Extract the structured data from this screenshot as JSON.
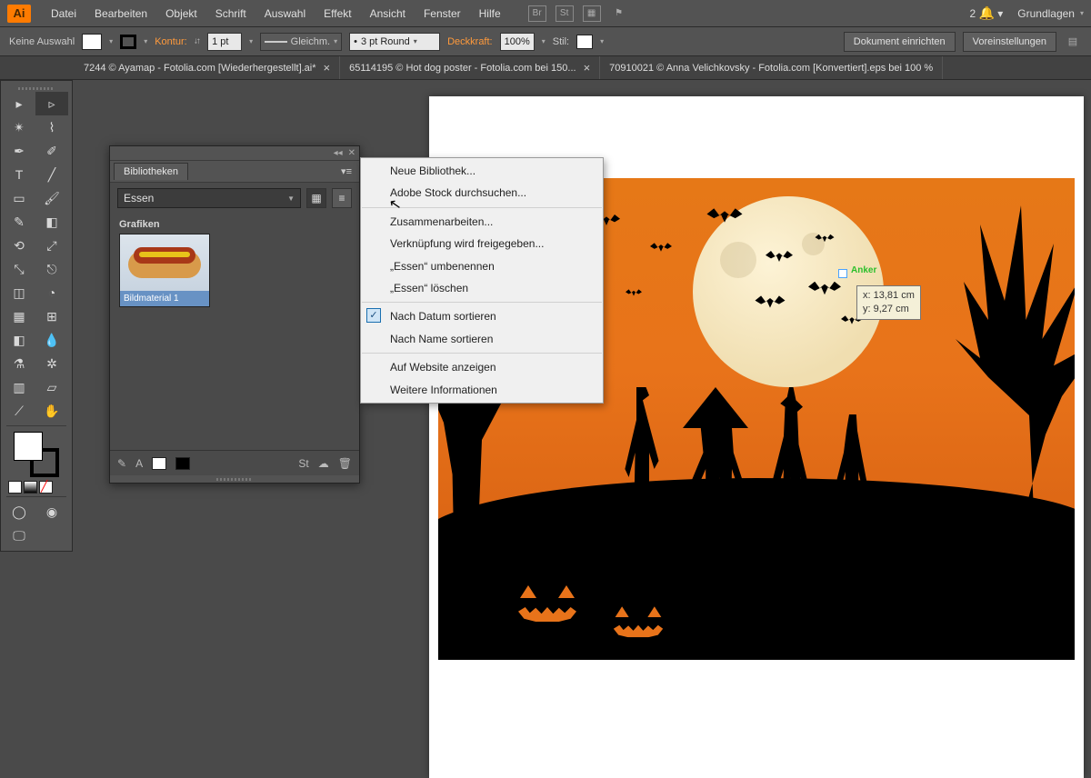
{
  "app": {
    "logo": "Ai"
  },
  "menu": [
    "Datei",
    "Bearbeiten",
    "Objekt",
    "Schrift",
    "Auswahl",
    "Effekt",
    "Ansicht",
    "Fenster",
    "Hilfe"
  ],
  "menubar_right": {
    "notif_count": "2",
    "workspace": "Grundlagen"
  },
  "control": {
    "selection": "Keine Auswahl",
    "stroke_label": "Kontur:",
    "stroke_val": "1 pt",
    "dash": "Gleichm.",
    "brush": "3 pt Round",
    "opacity_label": "Deckkraft:",
    "opacity_val": "100%",
    "style_label": "Stil:",
    "btn1": "Dokument einrichten",
    "btn2": "Voreinstellungen"
  },
  "tabs": [
    "7244 © Ayamap - Fotolia.com [Wiederhergestellt].ai*",
    "65114195 © Hot dog poster - Fotolia.com bei 150...",
    "70910021 © Anna Velichkovsky - Fotolia.com [Konvertiert].eps bei 100 %"
  ],
  "libraries": {
    "title": "Bibliotheken",
    "selected": "Essen",
    "section": "Grafiken",
    "thumb_label": "Bildmaterial 1"
  },
  "context_menu": {
    "items": [
      {
        "label": "Neue Bibliothek..."
      },
      {
        "label": "Adobe Stock durchsuchen..."
      },
      {
        "sep": true
      },
      {
        "label": "Zusammenarbeiten..."
      },
      {
        "label": "Verknüpfung wird freigegeben..."
      },
      {
        "label": "„Essen“ umbenennen"
      },
      {
        "label": "„Essen“ löschen"
      },
      {
        "sep": true
      },
      {
        "label": "Nach Datum sortieren",
        "checked": true
      },
      {
        "label": "Nach Name sortieren"
      },
      {
        "sep": true
      },
      {
        "label": "Auf Website anzeigen"
      },
      {
        "label": "Weitere Informationen"
      }
    ]
  },
  "tooltip": {
    "anchor": "Anker",
    "x_label": "x:",
    "x": "13,81 cm",
    "y_label": "y:",
    "y": "9,27 cm"
  }
}
